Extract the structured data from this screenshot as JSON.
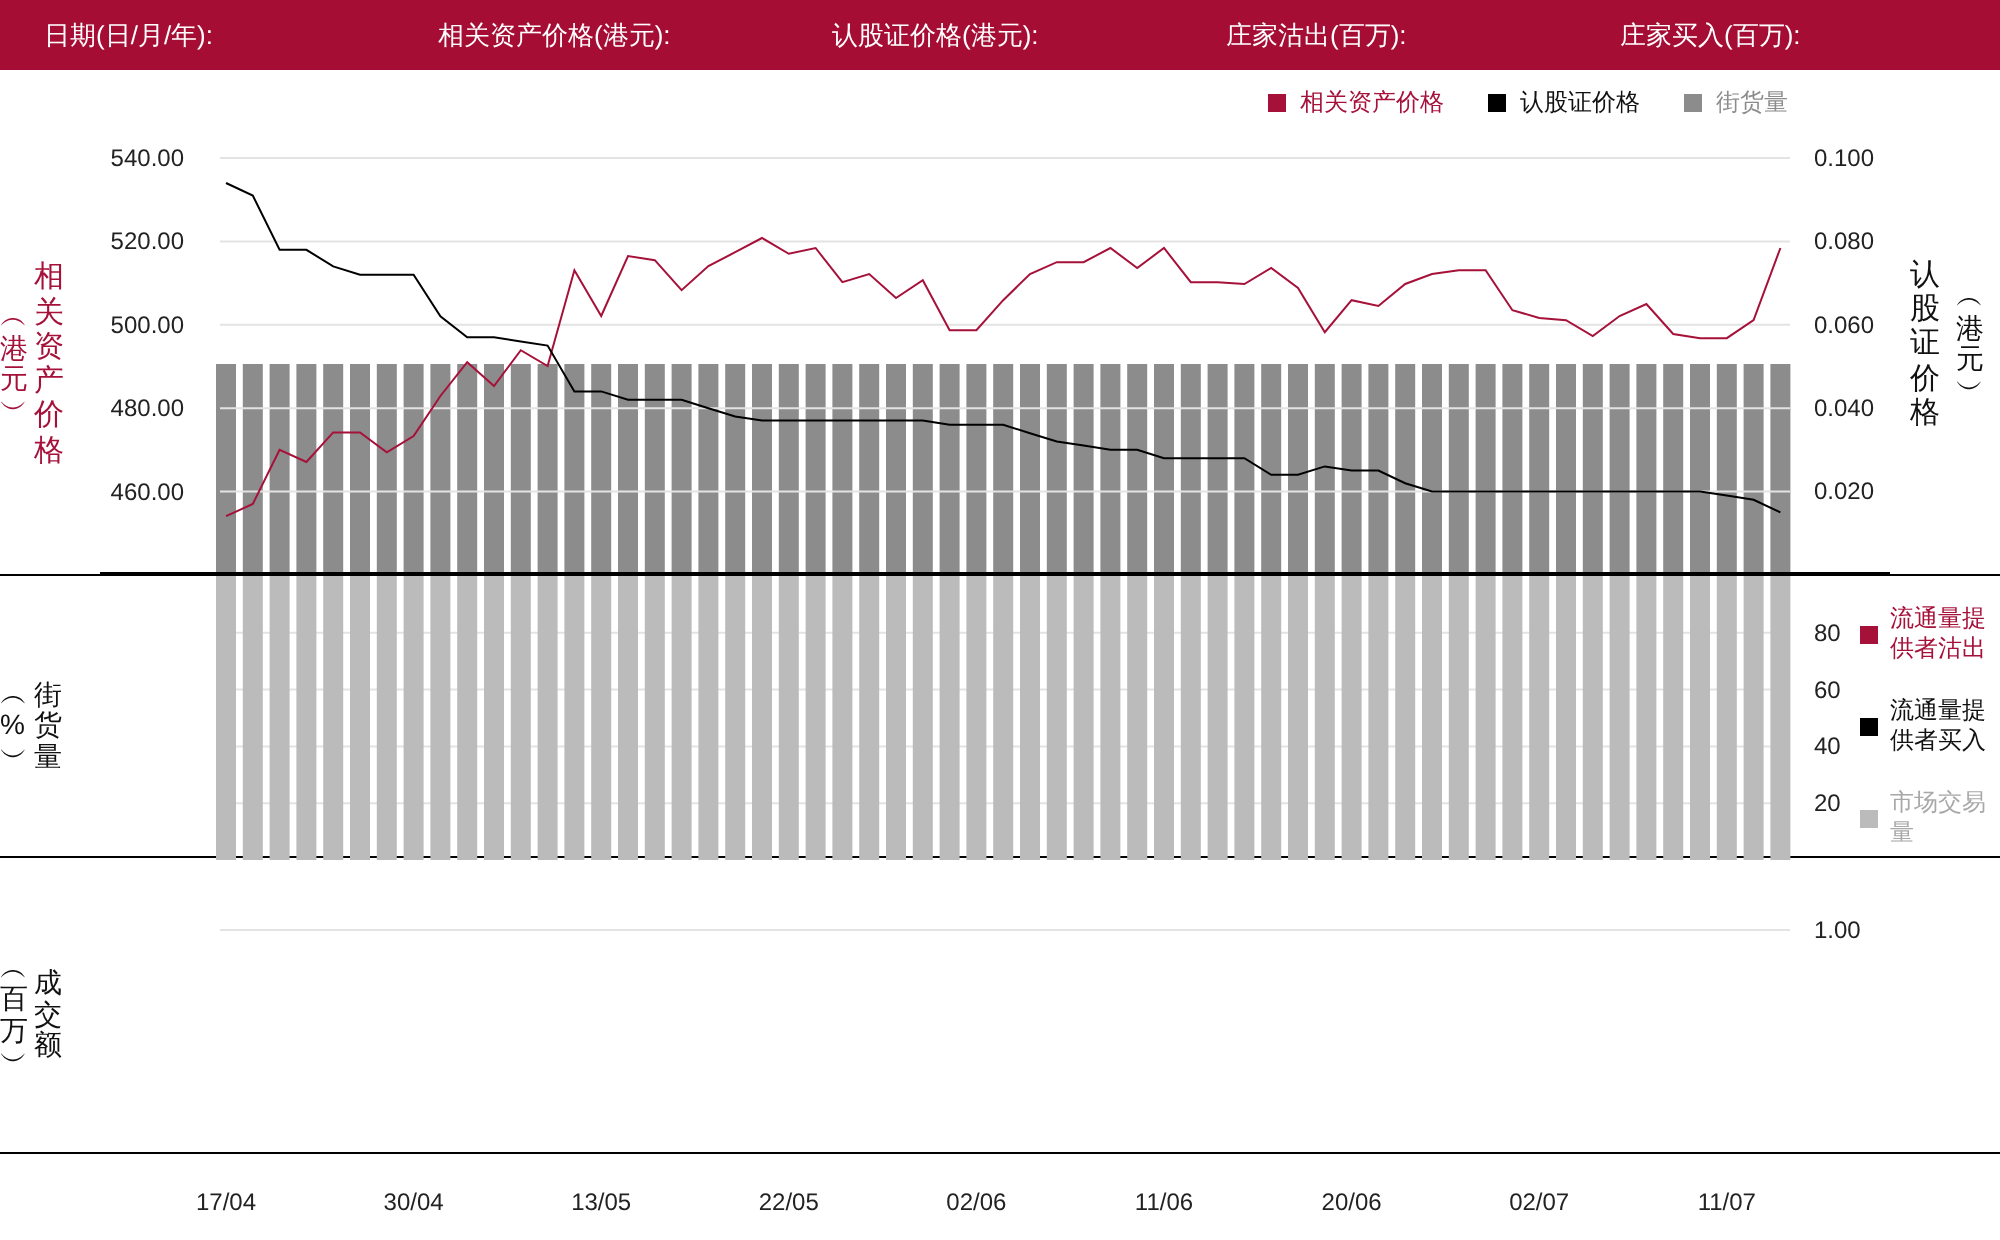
{
  "header": {
    "fields": [
      "日期(日/月/年):",
      "相关资产价格(港元):",
      "认股证价格(港元):",
      "庄家沽出(百万):",
      "庄家买入(百万):"
    ]
  },
  "price_chart": {
    "volume_legend": {
      "label": "街货量",
      "color": "#8c8c8c"
    },
    "left_label": "相关资产价格",
    "left_unit": "︵港元︶",
    "right_label": "认股证价格",
    "right_unit": "︵港元︶",
    "chart_data": {
      "type": "line",
      "grid": true,
      "ylim": [
        440.7,
        540
      ],
      "yticks": [
        {
          "value": 540,
          "label": "540.00"
        },
        {
          "value": 520,
          "label": "520.00"
        },
        {
          "value": 500,
          "label": "500.00"
        },
        {
          "value": 480,
          "label": "480.00"
        },
        {
          "value": 460,
          "label": "460.00"
        }
      ],
      "series": [
        {
          "name": "相关资产价格",
          "color": "#a6113a",
          "values": [
            454.1,
            457.0,
            470.0,
            467.1,
            474.2,
            474.2,
            469.4,
            473.3,
            482.9,
            491.0,
            485.3,
            493.9,
            490.1,
            513.1,
            502.1,
            516.5,
            515.5,
            508.3,
            514.1,
            517.4,
            520.8,
            517.0,
            518.4,
            510.2,
            512.2,
            506.4,
            510.7,
            498.7,
            498.7,
            505.9,
            512.2,
            515.0,
            515.0,
            518.4,
            513.6,
            518.4,
            510.2,
            510.2,
            509.8,
            513.6,
            508.8,
            498.2,
            505.9,
            504.5,
            509.8,
            512.2,
            513.1,
            513.1,
            503.5,
            501.6,
            501.1,
            497.3,
            502.1,
            505.0,
            497.8,
            496.8,
            496.8,
            501.1,
            518.4
          ]
        }
      ]
    }
  },
  "warrant_chart": {
    "chart_data": {
      "type": "line",
      "ylim": [
        0.0002,
        0.1
      ],
      "yticks": [
        {
          "value": 0.1,
          "label": "0.100"
        },
        {
          "value": 0.08,
          "label": "0.080"
        },
        {
          "value": 0.06,
          "label": "0.060"
        },
        {
          "value": 0.04,
          "label": "0.040"
        },
        {
          "value": 0.02,
          "label": "0.020"
        }
      ],
      "series": [
        {
          "name": "认股证价格",
          "color": "#000000",
          "values": [
            0.094,
            0.091,
            0.078,
            0.078,
            0.074,
            0.072,
            0.072,
            0.072,
            0.062,
            0.057,
            0.057,
            0.056,
            0.055,
            0.044,
            0.044,
            0.042,
            0.042,
            0.042,
            0.04,
            0.038,
            0.037,
            0.037,
            0.037,
            0.037,
            0.037,
            0.037,
            0.037,
            0.036,
            0.036,
            0.036,
            0.034,
            0.032,
            0.031,
            0.03,
            0.03,
            0.028,
            0.028,
            0.028,
            0.028,
            0.024,
            0.024,
            0.026,
            0.025,
            0.025,
            0.022,
            0.02,
            0.02,
            0.02,
            0.02,
            0.02,
            0.02,
            0.02,
            0.02,
            0.02,
            0.02,
            0.02,
            0.019,
            0.018,
            0.015
          ]
        }
      ]
    }
  },
  "holdings_panel": {
    "label": "街货量",
    "unit": "︵%︶",
    "legend": [
      {
        "label": "流通量提供者沽出",
        "color": "#a6113a"
      },
      {
        "label": "流通量提供者买入",
        "color": "#000000"
      },
      {
        "label": "市场交易量",
        "color": "#bbbbbb"
      }
    ],
    "chart_data": {
      "type": "bar",
      "grid": true,
      "ylim": [
        0,
        100
      ],
      "yticks": [
        20,
        40,
        60,
        80
      ],
      "series": [
        {
          "color": "#bbbbbb",
          "values": [
            100,
            100,
            100,
            100,
            100,
            100,
            100,
            100,
            100,
            100,
            100,
            100,
            100,
            100,
            100,
            100,
            100,
            100,
            100,
            100,
            100,
            100,
            100,
            100,
            100,
            100,
            100,
            100,
            100,
            100,
            100,
            100,
            100,
            100,
            100,
            100,
            100,
            100,
            100,
            100,
            100,
            100,
            100,
            100,
            100,
            100,
            100,
            100,
            100,
            100,
            100,
            100,
            100,
            100,
            100,
            100,
            100,
            100,
            100
          ]
        }
      ]
    }
  },
  "turnover_panel": {
    "label": "成交额",
    "unit": "︵百万︶",
    "ticks": [
      "1.00"
    ]
  },
  "dates": [
    "17/04",
    "30/04",
    "13/05",
    "22/05",
    "02/06",
    "11/06",
    "20/06",
    "02/07",
    "11/07"
  ]
}
